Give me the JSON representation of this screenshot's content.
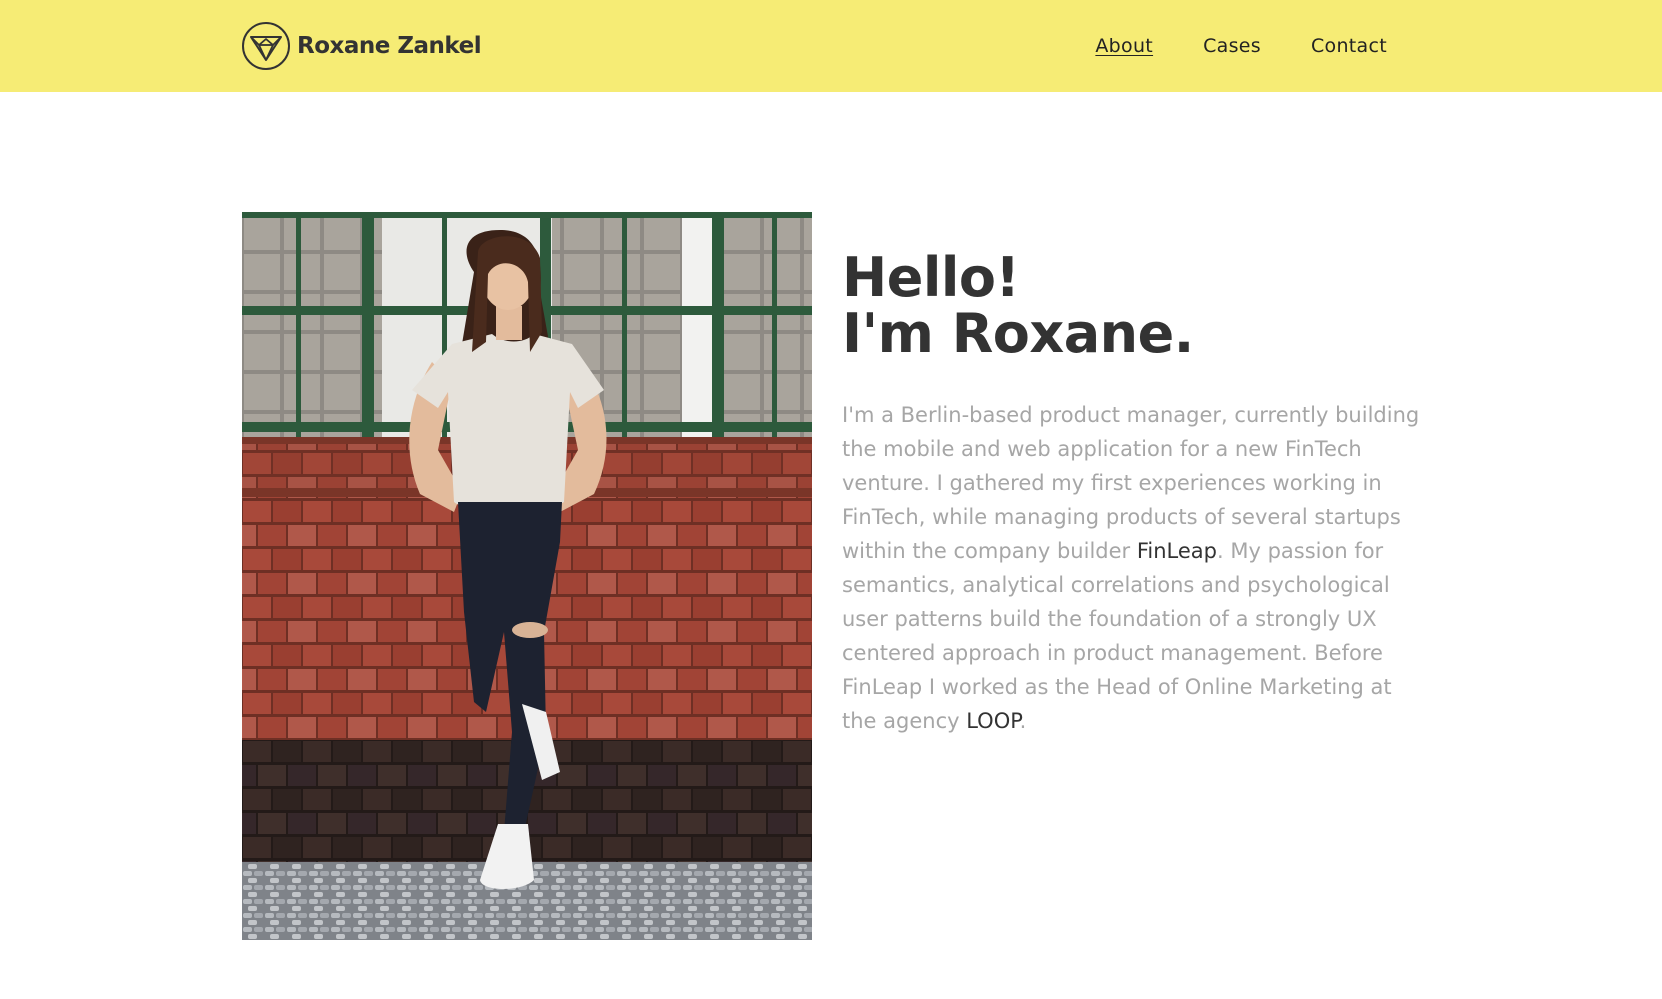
{
  "header": {
    "brand_name": "Roxane Zankel",
    "logo_icon": "diamond-gem-icon",
    "nav": [
      {
        "label": "About",
        "active": true
      },
      {
        "label": "Cases",
        "active": false
      },
      {
        "label": "Contact",
        "active": false
      }
    ]
  },
  "intro": {
    "heading_line1": "Hello!",
    "heading_line2": "I'm Roxane.",
    "bio_part1": "I'm a Berlin-based product manager, currently building the mobile and web application for a new FinTech venture. I gathered my first experiences working in FinTech, while managing products of several startups within the company builder ",
    "bio_link1": "FinLeap",
    "bio_part2": ". My passion for semantics, analytical correlations and psychological user patterns build the foundation of a strongly UX centered approach in product management. Before FinLeap I worked as the Head of Online Marketing at the agency ",
    "bio_link2": "LOOP",
    "bio_part3": "."
  },
  "colors": {
    "header_bg": "#f6ec75",
    "heading": "#333333",
    "body_text": "#a6a6a6",
    "link_text": "#333333"
  }
}
